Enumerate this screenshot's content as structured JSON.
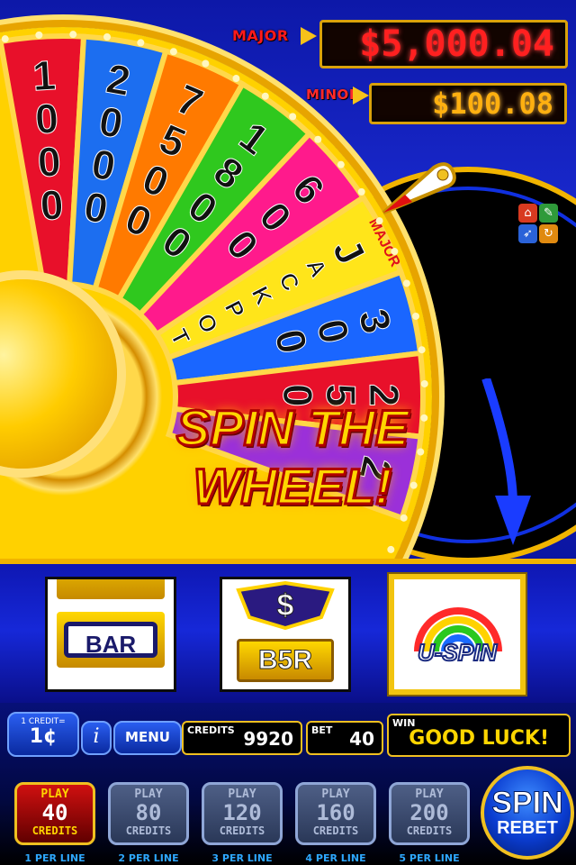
{
  "jackpots": {
    "major_label": "MAJOR",
    "major_value": "$5,000.04",
    "minor_label": "MINOR",
    "minor_value": "$100.08"
  },
  "wheel": {
    "segments": [
      {
        "text": "1000",
        "color": "#e8102a"
      },
      {
        "text": "2000",
        "color": "#1c6ef0"
      },
      {
        "text": "7500",
        "color": "#ff7a00"
      },
      {
        "text": "1800",
        "color": "#2fc81e"
      },
      {
        "text": "600",
        "color": "#ff1a8c"
      },
      {
        "text": "JACKPOT",
        "tag": "MAJOR",
        "color": "#ffe51a"
      },
      {
        "text": "300",
        "color": "#1a66ff"
      },
      {
        "text": "250",
        "color": "#e8102a"
      },
      {
        "text": "2",
        "color": "#9b30d9"
      }
    ]
  },
  "banner": "SPIN THE WHEEL!",
  "reels": [
    {
      "symbol": "BAR"
    },
    {
      "symbol": "B5R",
      "top": "$"
    },
    {
      "symbol": "U-SPIN"
    }
  ],
  "controls": {
    "denom_label": "1 CREDIT=",
    "denom_value": "1¢",
    "info_label": "i",
    "menu_label": "MENU",
    "credits_label": "CREDITS",
    "credits_value": "9920",
    "bet_label": "BET",
    "bet_value": "40",
    "win_label": "WIN",
    "win_value": "GOOD LUCK!"
  },
  "play_buttons": [
    {
      "play": "PLAY",
      "amount": "40",
      "unit": "CREDITS",
      "per_line": "1 PER LINE",
      "active": true
    },
    {
      "play": "PLAY",
      "amount": "80",
      "unit": "CREDITS",
      "per_line": "2 PER LINE",
      "active": false
    },
    {
      "play": "PLAY",
      "amount": "120",
      "unit": "CREDITS",
      "per_line": "3 PER LINE",
      "active": false
    },
    {
      "play": "PLAY",
      "amount": "160",
      "unit": "CREDITS",
      "per_line": "4 PER LINE",
      "active": false
    },
    {
      "play": "PLAY",
      "amount": "200",
      "unit": "CREDITS",
      "per_line": "5 PER LINE",
      "active": false
    }
  ],
  "spin_button": {
    "line1": "SPIN",
    "line2": "REBET"
  }
}
